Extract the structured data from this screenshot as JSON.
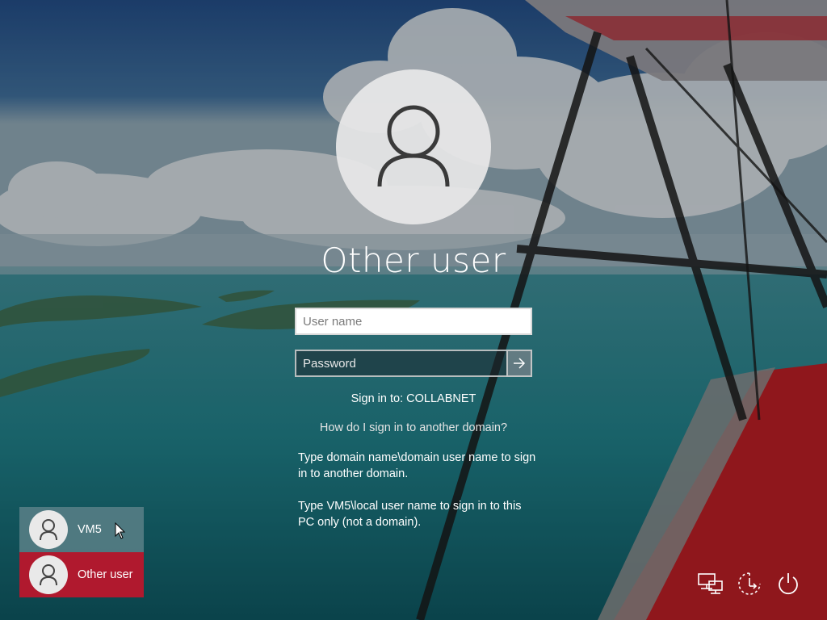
{
  "screen": {
    "title": "Other user",
    "user_name_placeholder": "User name",
    "password_placeholder": "Password",
    "sign_in_to": "Sign in to: COLLABNET",
    "help_link": "How do I sign in to another domain?",
    "help_text_1": "Type domain name\\domain user name to sign in to another domain.",
    "help_text_2": "Type VM5\\local user name to sign in to this PC only (not a domain)."
  },
  "users": [
    {
      "label": "VM5"
    },
    {
      "label": "Other user"
    }
  ],
  "system_icons": [
    "network-icon",
    "ease-of-access-icon",
    "power-icon"
  ],
  "colors": {
    "selected_tile": "#b0192e",
    "hover_tile": "#5a8087",
    "text": "#ffffff"
  }
}
